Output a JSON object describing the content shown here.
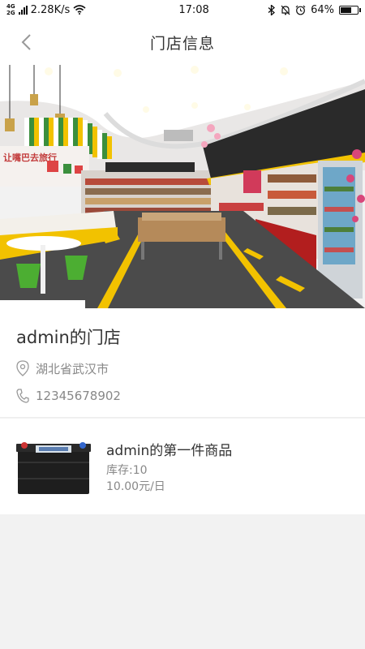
{
  "status_bar": {
    "network_type_top": "4G",
    "network_type_bottom": "2G",
    "speed": "2.28K/s",
    "time": "17:08",
    "battery_percent": "64%",
    "battery_level": 0.64
  },
  "nav": {
    "title": "门店信息"
  },
  "store": {
    "name": "admin的门店",
    "address": "湖北省武汉市",
    "phone": "12345678902",
    "hero_sign_text": "让嘴巴去旅行"
  },
  "product": {
    "name": "admin的第一件商品",
    "stock": "库存:10",
    "price": "10.00元/日"
  },
  "colors": {
    "accent_yellow": "#f2c200",
    "divider": "#eeeeee",
    "page_bg": "#f2f2f2"
  }
}
